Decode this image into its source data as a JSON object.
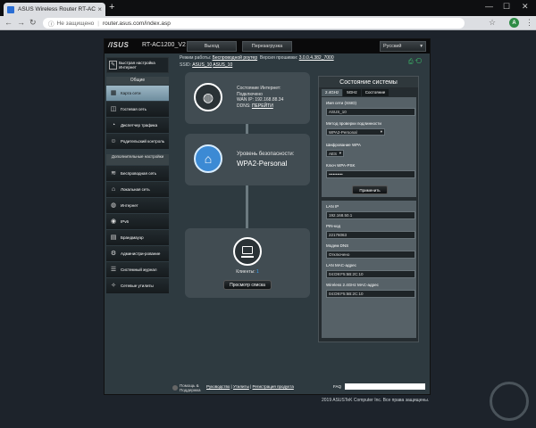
{
  "browser": {
    "tab_title": "ASUS Wireless Router RT-AC1200",
    "address_insecure": "Не защищено",
    "address_url": "router.asus.com/index.asp",
    "profile_initial": "A"
  },
  "header": {
    "logo": "/ISUS",
    "model": "RT-AC1200_V2",
    "logout": "Выход",
    "reboot": "Перезагрузка",
    "language": "Русский",
    "mode_label": "Режим работы:",
    "mode_value": "Беспроводной роутер",
    "fw_label": "Версия прошивки:",
    "fw_value": "3.0.0.4.382_7000",
    "ssid_label": "SSID:",
    "ssid_24": "ASUS_10",
    "ssid_5": "ASUS_10"
  },
  "sidebar": {
    "quick_setup": "Быстрая настройка Интернет",
    "general_header": "Общие",
    "general_items": [
      {
        "label": "Карта сети",
        "icon": "▦"
      },
      {
        "label": "Гостевая сеть",
        "icon": "◫"
      },
      {
        "label": "Диспетчер трафика",
        "icon": "◔"
      },
      {
        "label": "Родительский контроль",
        "icon": "☺"
      }
    ],
    "advanced_header": "Дополнительные настройки",
    "advanced_items": [
      {
        "label": "Беспроводная сеть",
        "icon": "≋"
      },
      {
        "label": "Локальная сеть",
        "icon": "⌂"
      },
      {
        "label": "Интернет",
        "icon": "◍"
      },
      {
        "label": "IPv6",
        "icon": "◉"
      },
      {
        "label": "Брандмауэр",
        "icon": "▤"
      },
      {
        "label": "Администри-рование",
        "icon": "⚙"
      },
      {
        "label": "Системный журнал",
        "icon": "☰"
      },
      {
        "label": "Сетевые утилиты",
        "icon": "✧"
      }
    ]
  },
  "map": {
    "internet_status_label": "Состояние Интернет:",
    "internet_status": "Подключено",
    "wan_ip_label": "WAN IP:",
    "wan_ip": "192.168.88.34",
    "ddns_label": "DDNS:",
    "ddns_link": "ПЕРЕЙТИ",
    "security_label": "Уровень безопасности:",
    "security_value": "WPA2-Personal",
    "clients_label": "Клиенты:",
    "clients_count": "1",
    "view_list": "Просмотр списка"
  },
  "status": {
    "title": "Состояние системы",
    "tabs": [
      "2.4GHz",
      "5GHz",
      "Состояние"
    ],
    "ssid_label": "Имя сети (SSID)",
    "ssid_value": "ASUS_10",
    "auth_label": "Метод проверки подлинности",
    "auth_value": "WPA2-Personal",
    "enc_label": "Шифрование WPA",
    "enc_value": "AES",
    "key_label": "Ключ WPA-PSK",
    "key_value": "••••••••••",
    "apply": "Применить",
    "lan_ip_label": "LAN IP",
    "lan_ip": "192.168.50.1",
    "pin_label": "PIN-код",
    "pin": "22176063",
    "ipoe_label": "Модем DNS",
    "ipoe": "Отключено",
    "lan_mac_label": "LAN MAC-адрес",
    "lan_mac": "04:D9:F5:5B:2C:10",
    "wl_mac_label": "Wireless 2.4GHz MAC-адрес",
    "wl_mac": "04:D9:F5:5B:2C:10"
  },
  "footer": {
    "help": "Помощь & Поддержка",
    "manual": "Руководство",
    "utility": "Утилиты",
    "register": "Регистрация продукта",
    "faq": "FAQ",
    "copyright": "2019 ASUSTeK Computer Inc. Все права защищены."
  }
}
